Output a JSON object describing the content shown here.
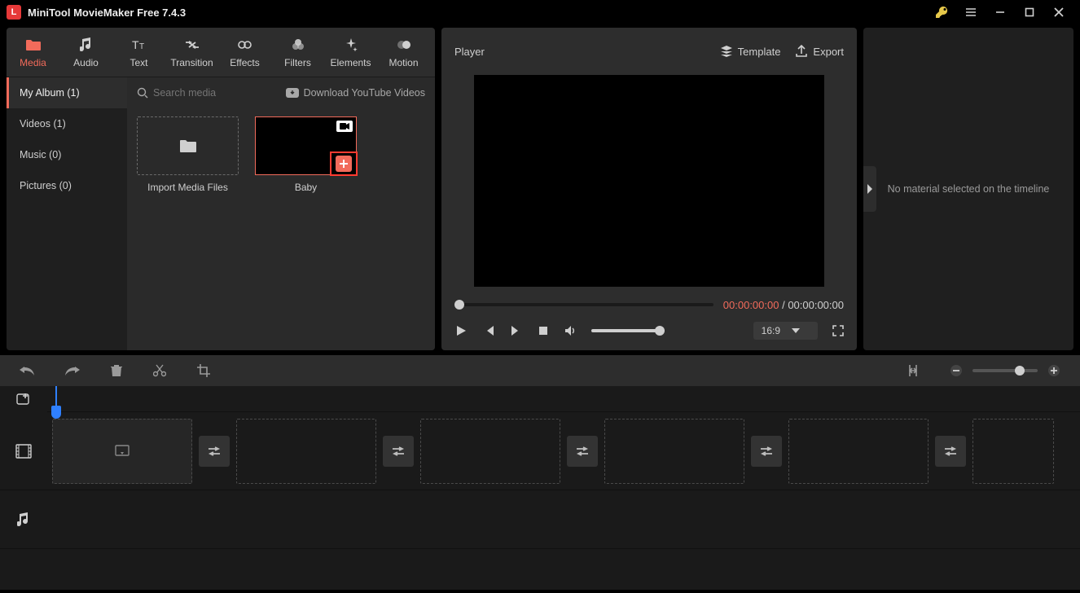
{
  "app": {
    "title": "MiniTool MovieMaker Free 7.4.3"
  },
  "toolbar": {
    "media": "Media",
    "audio": "Audio",
    "text": "Text",
    "transition": "Transition",
    "effects": "Effects",
    "filters": "Filters",
    "elements": "Elements",
    "motion": "Motion"
  },
  "sidebar": {
    "items": [
      {
        "label": "My Album (1)"
      },
      {
        "label": "Videos (1)"
      },
      {
        "label": "Music (0)"
      },
      {
        "label": "Pictures (0)"
      }
    ]
  },
  "media": {
    "search_placeholder": "Search media",
    "download_label": "Download YouTube Videos",
    "import_label": "Import Media Files",
    "clip_name": "Baby"
  },
  "player": {
    "title": "Player",
    "template_label": "Template",
    "export_label": "Export",
    "time_current": "00:00:00:00",
    "time_sep": " / ",
    "time_total": "00:00:00:00",
    "aspect": "16:9"
  },
  "right_panel": {
    "message": "No material selected on the timeline"
  }
}
